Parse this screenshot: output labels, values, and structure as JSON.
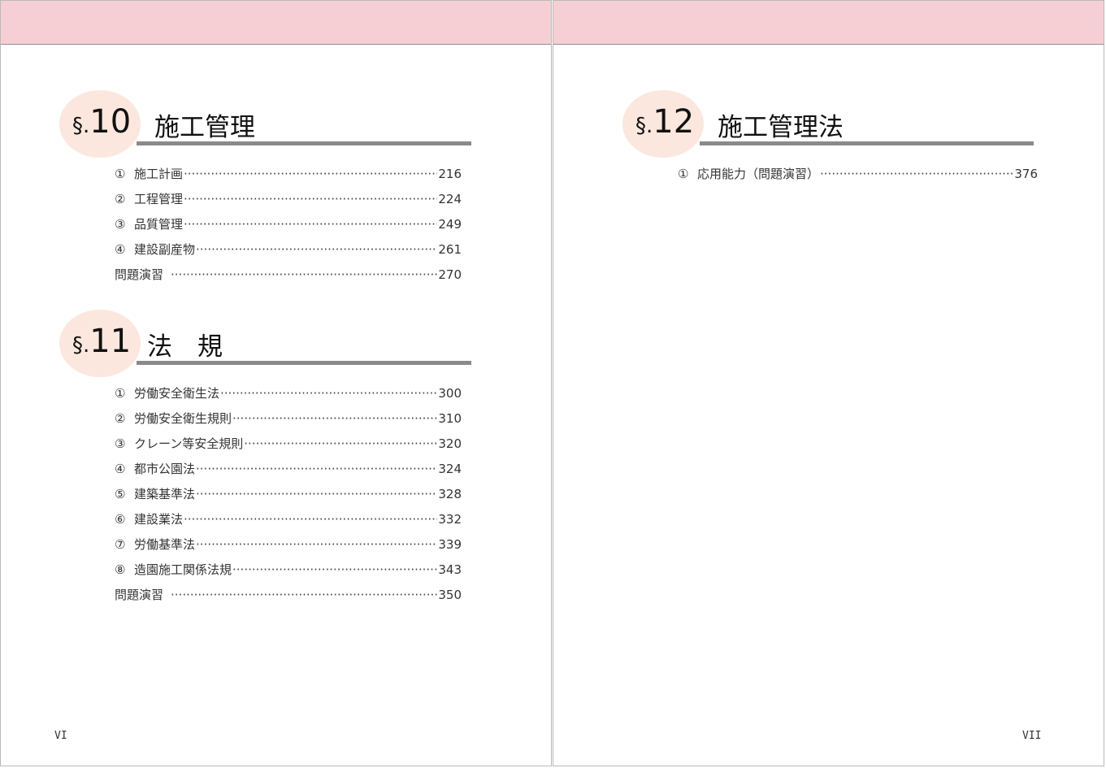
{
  "left_page": {
    "sections": [
      {
        "symbol": "§.",
        "number": "10",
        "title": "施工管理",
        "entries": [
          {
            "mark": "①",
            "label": "施工計画",
            "page": "216"
          },
          {
            "mark": "②",
            "label": "工程管理",
            "page": "224"
          },
          {
            "mark": "③",
            "label": "品質管理",
            "page": "249"
          },
          {
            "mark": "④",
            "label": "建設副産物",
            "page": "261"
          },
          {
            "mark": "",
            "label": "問題演習",
            "page": "270"
          }
        ]
      },
      {
        "symbol": "§.",
        "number": "11",
        "title": "法　規",
        "entries": [
          {
            "mark": "①",
            "label": "労働安全衛生法",
            "page": "300"
          },
          {
            "mark": "②",
            "label": "労働安全衛生規則",
            "page": "310"
          },
          {
            "mark": "③",
            "label": "クレーン等安全規則",
            "page": "320"
          },
          {
            "mark": "④",
            "label": "都市公園法",
            "page": "324"
          },
          {
            "mark": "⑤",
            "label": "建築基準法",
            "page": "328"
          },
          {
            "mark": "⑥",
            "label": "建設業法",
            "page": "332"
          },
          {
            "mark": "⑦",
            "label": "労働基準法",
            "page": "339"
          },
          {
            "mark": "⑧",
            "label": "造園施工関係法規",
            "page": "343"
          },
          {
            "mark": "",
            "label": "問題演習",
            "page": "350"
          }
        ]
      }
    ],
    "folio": "VI"
  },
  "right_page": {
    "sections": [
      {
        "symbol": "§.",
        "number": "12",
        "title": "施工管理法",
        "entries": [
          {
            "mark": "①",
            "label": "応用能力（問題演習）",
            "page": "376"
          }
        ]
      }
    ],
    "folio": "VII"
  },
  "colors": {
    "header_band": "#f6cfd5",
    "section_circle": "#fbe7dd",
    "title_rule": "#8a8a8a"
  }
}
